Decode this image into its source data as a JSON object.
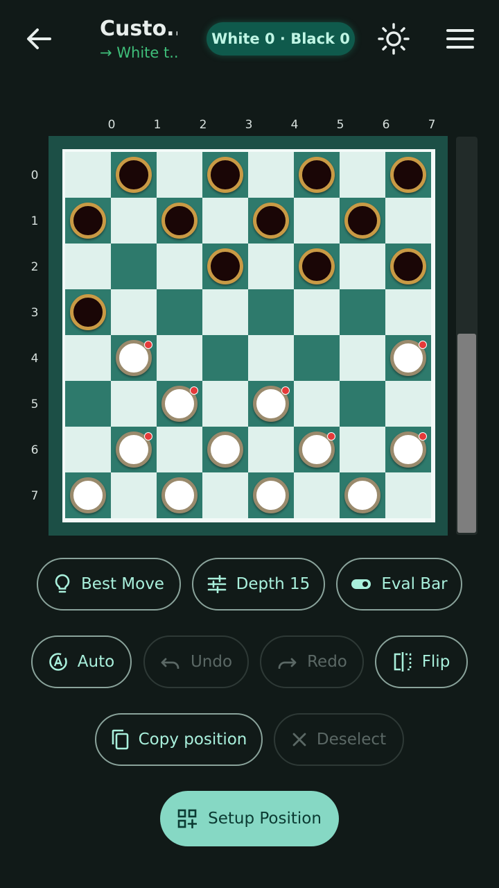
{
  "header": {
    "title": "Custo...",
    "subtitle": "→ White t...",
    "score": "White 0 · Black 0"
  },
  "board": {
    "col_labels": [
      "0",
      "1",
      "2",
      "3",
      "4",
      "5",
      "6",
      "7"
    ],
    "row_labels": [
      "0",
      "1",
      "2",
      "3",
      "4",
      "5",
      "6",
      "7"
    ],
    "colors": {
      "light": "#dff1ec",
      "dark": "#2e7a6c"
    },
    "pieces": [
      {
        "row": 0,
        "col": 1,
        "color": "black"
      },
      {
        "row": 0,
        "col": 3,
        "color": "black"
      },
      {
        "row": 0,
        "col": 5,
        "color": "black"
      },
      {
        "row": 0,
        "col": 7,
        "color": "black"
      },
      {
        "row": 1,
        "col": 0,
        "color": "black"
      },
      {
        "row": 1,
        "col": 2,
        "color": "black"
      },
      {
        "row": 1,
        "col": 4,
        "color": "black"
      },
      {
        "row": 1,
        "col": 6,
        "color": "black"
      },
      {
        "row": 2,
        "col": 3,
        "color": "black"
      },
      {
        "row": 2,
        "col": 5,
        "color": "black"
      },
      {
        "row": 2,
        "col": 7,
        "color": "black"
      },
      {
        "row": 3,
        "col": 0,
        "color": "black"
      },
      {
        "row": 4,
        "col": 1,
        "color": "white",
        "movable": true
      },
      {
        "row": 4,
        "col": 7,
        "color": "white",
        "movable": true
      },
      {
        "row": 5,
        "col": 2,
        "color": "white",
        "movable": true
      },
      {
        "row": 5,
        "col": 4,
        "color": "white",
        "movable": true
      },
      {
        "row": 6,
        "col": 1,
        "color": "white",
        "movable": true
      },
      {
        "row": 6,
        "col": 3,
        "color": "white"
      },
      {
        "row": 6,
        "col": 5,
        "color": "white",
        "movable": true
      },
      {
        "row": 6,
        "col": 7,
        "color": "white",
        "movable": true
      },
      {
        "row": 7,
        "col": 0,
        "color": "white"
      },
      {
        "row": 7,
        "col": 2,
        "color": "white"
      },
      {
        "row": 7,
        "col": 4,
        "color": "white"
      },
      {
        "row": 7,
        "col": 6,
        "color": "white"
      }
    ]
  },
  "eval_bar": {
    "white_fraction": 0.5
  },
  "controls": {
    "best_move": "Best Move",
    "depth": "Depth 15",
    "eval_bar": "Eval Bar",
    "auto": "Auto",
    "undo": "Undo",
    "redo": "Redo",
    "flip": "Flip",
    "copy_position": "Copy position",
    "deselect": "Deselect",
    "setup_position": "Setup Position"
  },
  "icons": [
    "back-arrow-icon",
    "brightness-icon",
    "menu-icon",
    "lightbulb-icon",
    "tune-icon",
    "toggle-icon",
    "auto-icon",
    "undo-icon",
    "redo-icon",
    "flip-icon",
    "copy-icon",
    "close-icon",
    "grid-add-icon"
  ]
}
